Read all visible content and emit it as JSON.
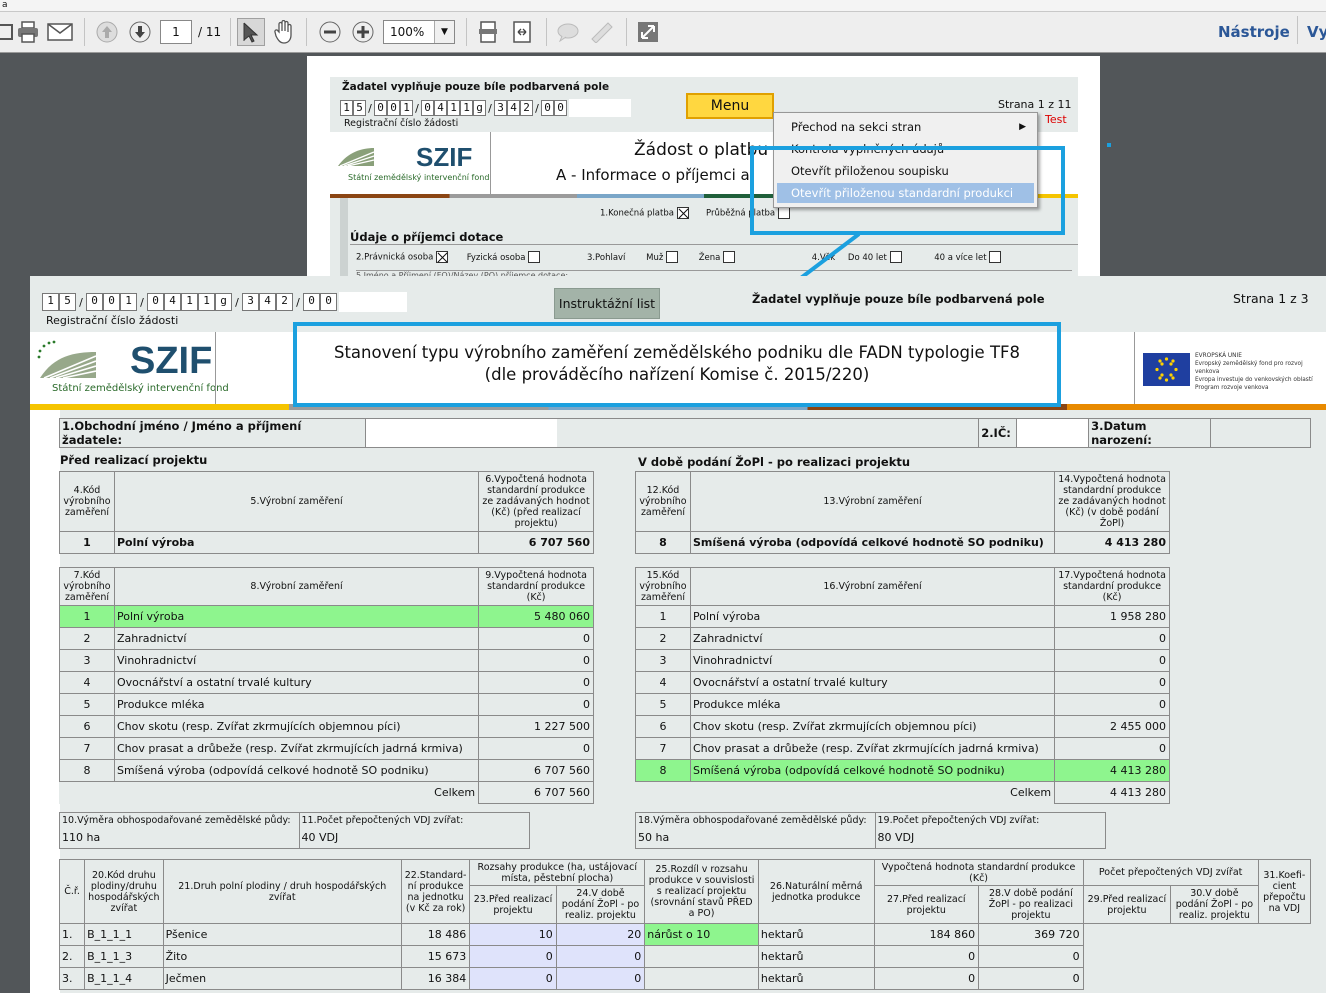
{
  "window": {
    "title_fragment": "a"
  },
  "toolbar": {
    "page_current": "1",
    "page_total": "/ 11",
    "zoom": "100%",
    "tools_label": "Nástroje",
    "right_label": "Vy",
    "icons": [
      "save-icon",
      "print-icon",
      "email-icon",
      "page-up-icon",
      "page-down-icon",
      "select-icon",
      "hand-icon",
      "zoom-out-icon",
      "zoom-in-icon",
      "fit-page-icon",
      "fit-width-icon",
      "comment-icon",
      "sign-icon",
      "fullscreen-icon"
    ]
  },
  "back_page": {
    "instruction": "Žadatel vyplňuje pouze bíle podbarvená pole",
    "reg_chars": [
      "1",
      "5",
      "/",
      "0",
      "0",
      "1",
      "/",
      "0",
      "4",
      "1",
      "1",
      "g",
      "/",
      "3",
      "4",
      "2",
      "/",
      "0",
      "0"
    ],
    "reg_label": "Registrační číslo žádosti",
    "menu_button": "Menu",
    "page_info": "Strana 1 z 11",
    "test_label": "Test",
    "title": "Žádost o platbu",
    "subtitle": "A - Informace o příjemci a",
    "logo_text": "SZIF",
    "logo_subtext": "Státní zemědělský intervenční fond",
    "payment_final": "1.Konečná platba",
    "payment_partial": "Průběžná platba",
    "section_title": "Údaje o příjemci dotace",
    "legal_person": "2.Právnická osoba",
    "natural_person": "Fyzická osoba",
    "gender_label": "3.Pohlaví",
    "male": "Muž",
    "female": "Žena",
    "age_label": "4.Věk",
    "age_under": "Do 40 let",
    "age_over": "40 a více let",
    "cut_line": "5.Jméno a Příjmení (FO)/Název (PO) příjemce dotace:"
  },
  "context_menu": {
    "items": [
      "Přechod na sekci stran",
      "Kontrola vyplněných údajů",
      "Otevřít přiloženou soupisku",
      "Otevřít přiloženou standardní produkci"
    ],
    "selected_index": 3
  },
  "front_page": {
    "reg_chars": [
      "1",
      "5",
      "/",
      "0",
      "0",
      "1",
      "/",
      "0",
      "4",
      "1",
      "1",
      "g",
      "/",
      "3",
      "4",
      "2",
      "/",
      "0",
      "0"
    ],
    "reg_label": "Registrační číslo žádosti",
    "instr_button": "Instruktážní list",
    "instruction": "Žadatel vyplňuje pouze bíle podbarvená pole",
    "page_info": "Strana 1 z 3",
    "logo_text": "SZIF",
    "logo_subtext": "Státní zemědělský intervenční fond",
    "title_line1": "Stanovení typu výrobního zaměření zemědělského podniku dle FADN typologie TF8",
    "title_line2": "(dle prováděcího nařízení Komise č. 2015/220)",
    "eu_lines": [
      "EVROPSKÁ UNIE",
      "Evropský zemědělský fond pro rozvoj venkova",
      "Evropa investuje do venkovských oblastí",
      "Program rozvoje venkova"
    ],
    "field1": "1.Obchodní jméno / Jméno a příjmení žadatele:",
    "field2": "2.IČ:",
    "field3": "3.Datum narození:",
    "left_title": "Před realizací projektu",
    "right_title": "V době podání ŽoPl - po realizaci projektu",
    "lt1_h": [
      "4.Kód výrobního zaměření",
      "5.Výrobní zaměření",
      "6.Vypočtená hodnota standardní produkce ze zadávaných hodnot (Kč) (před realizací projektu)"
    ],
    "lt1_row": [
      "1",
      "Polní výroba",
      "6 707 560"
    ],
    "rt1_h": [
      "12.Kód výrobního zaměření",
      "13.Výrobní zaměření",
      "14.Vypočtená hodnota standardní produkce ze zadávaných hodnot (Kč) (v době podání ŽoPl)"
    ],
    "rt1_row": [
      "8",
      "Smíšená výroba (odpovídá celkové hodnotě SO podniku)",
      "4 413 280"
    ],
    "lt2_h": [
      "7.Kód výrobního zaměření",
      "8.Výrobní zaměření",
      "9.Vypočtená hodnota standardní produkce (Kč)"
    ],
    "rt2_h": [
      "15.Kód výrobního zaměření",
      "16.Výrobní zaměření",
      "17.Vypočtená hodnota standardní produkce (Kč)"
    ],
    "categories": [
      {
        "code": "1",
        "name": "Polní výroba",
        "before": "5 480 060",
        "after": "1 958 280"
      },
      {
        "code": "2",
        "name": "Zahradnictví",
        "before": "0",
        "after": "0"
      },
      {
        "code": "3",
        "name": "Vinohradnictví",
        "before": "0",
        "after": "0"
      },
      {
        "code": "4",
        "name": "Ovocnářství a ostatní trvalé kultury",
        "before": "0",
        "after": "0"
      },
      {
        "code": "5",
        "name": "Produkce mléka",
        "before": "0",
        "after": "0"
      },
      {
        "code": "6",
        "name": "Chov skotu (resp. Zvířat zkrmujících objemnou píci)",
        "before": "1 227 500",
        "after": "2 455 000"
      },
      {
        "code": "7",
        "name": "Chov prasat a drůbeže (resp. Zvířat zkrmujících jadrná krmiva)",
        "before": "0",
        "after": "0"
      },
      {
        "code": "8",
        "name": "Smíšená výroba (odpovídá celkové hodnotě SO podniku)",
        "before": "6 707 560",
        "after": "4 413 280"
      }
    ],
    "total_label": "Celkem",
    "total_before": "6 707 560",
    "total_after": "4 413 280",
    "area_left_label": "10.Výměra obhospodařované zemědělské půdy:",
    "area_left_value": "110 ha",
    "vdj_left_label": "11.Počet přepočtených VDJ zvířat:",
    "vdj_left_value": "40 VDJ",
    "area_right_label": "18.Výměra obhospodařované zemědělské půdy:",
    "area_right_value": "50 ha",
    "vdj_right_label": "19.Počet přepočtených VDJ zvířat:",
    "vdj_right_value": "80 VDJ",
    "crop_headers": {
      "cr": "Č.ř.",
      "code": "20.Kód druhu plodiny/druhu hospodářských zvířat",
      "name": "21.Druh polní plodiny / druh hospodářských zvířat",
      "std": "22.Standard-ní produkce na jednotku (v Kč za rok)",
      "range": "Rozsahy produkce (ha, ustájovací místa, pěstební plocha)",
      "before": "23.Před realizací projektu",
      "after": "24.V době podání ŽoPl - po realiz. projektu",
      "diff": "25.Rozdíl v rozsahu produkce v souvislosti s realizací projektu (srovnání stavů PŘED a PO)",
      "unit": "26.Naturální měrná jednotka produkce",
      "calc": "Vypočtená hodnota standardní produkce (Kč)",
      "calc_before": "27.Před realizací projektu",
      "calc_after": "28.V době podání ŽoPl - po realizaci projektu",
      "vdj": "Počet přepočtených VDJ zvířat",
      "vdj_before": "29.Před realizací projektu",
      "vdj_after": "30.V době podání ŽoPl - po realiz. projektu",
      "coef": "31.Koefi-cient přepočtu na VDJ"
    },
    "crops": [
      {
        "n": "1.",
        "code": "B_1_1_1",
        "name": "Pšenice",
        "std": "18 486",
        "before": "10",
        "after": "20",
        "diff": "nárůst o 10",
        "unit": "hektarů",
        "calc_before": "184 860",
        "calc_after": "369 720"
      },
      {
        "n": "2.",
        "code": "B_1_1_3",
        "name": "Žito",
        "std": "15 673",
        "before": "0",
        "after": "0",
        "diff": "",
        "unit": "hektarů",
        "calc_before": "0",
        "calc_after": "0"
      },
      {
        "n": "3.",
        "code": "B_1_1_4",
        "name": "Ječmen",
        "std": "16 384",
        "before": "0",
        "after": "0",
        "diff": "",
        "unit": "hektarů",
        "calc_before": "0",
        "calc_after": "0"
      }
    ]
  },
  "colors": {
    "highlight_green": "#8ef58e",
    "callout_blue": "#1ba0df",
    "menu_selected": "#9fc0e6",
    "form_bg": "#e6ebea",
    "menu_button_bg": "#ffd740"
  }
}
